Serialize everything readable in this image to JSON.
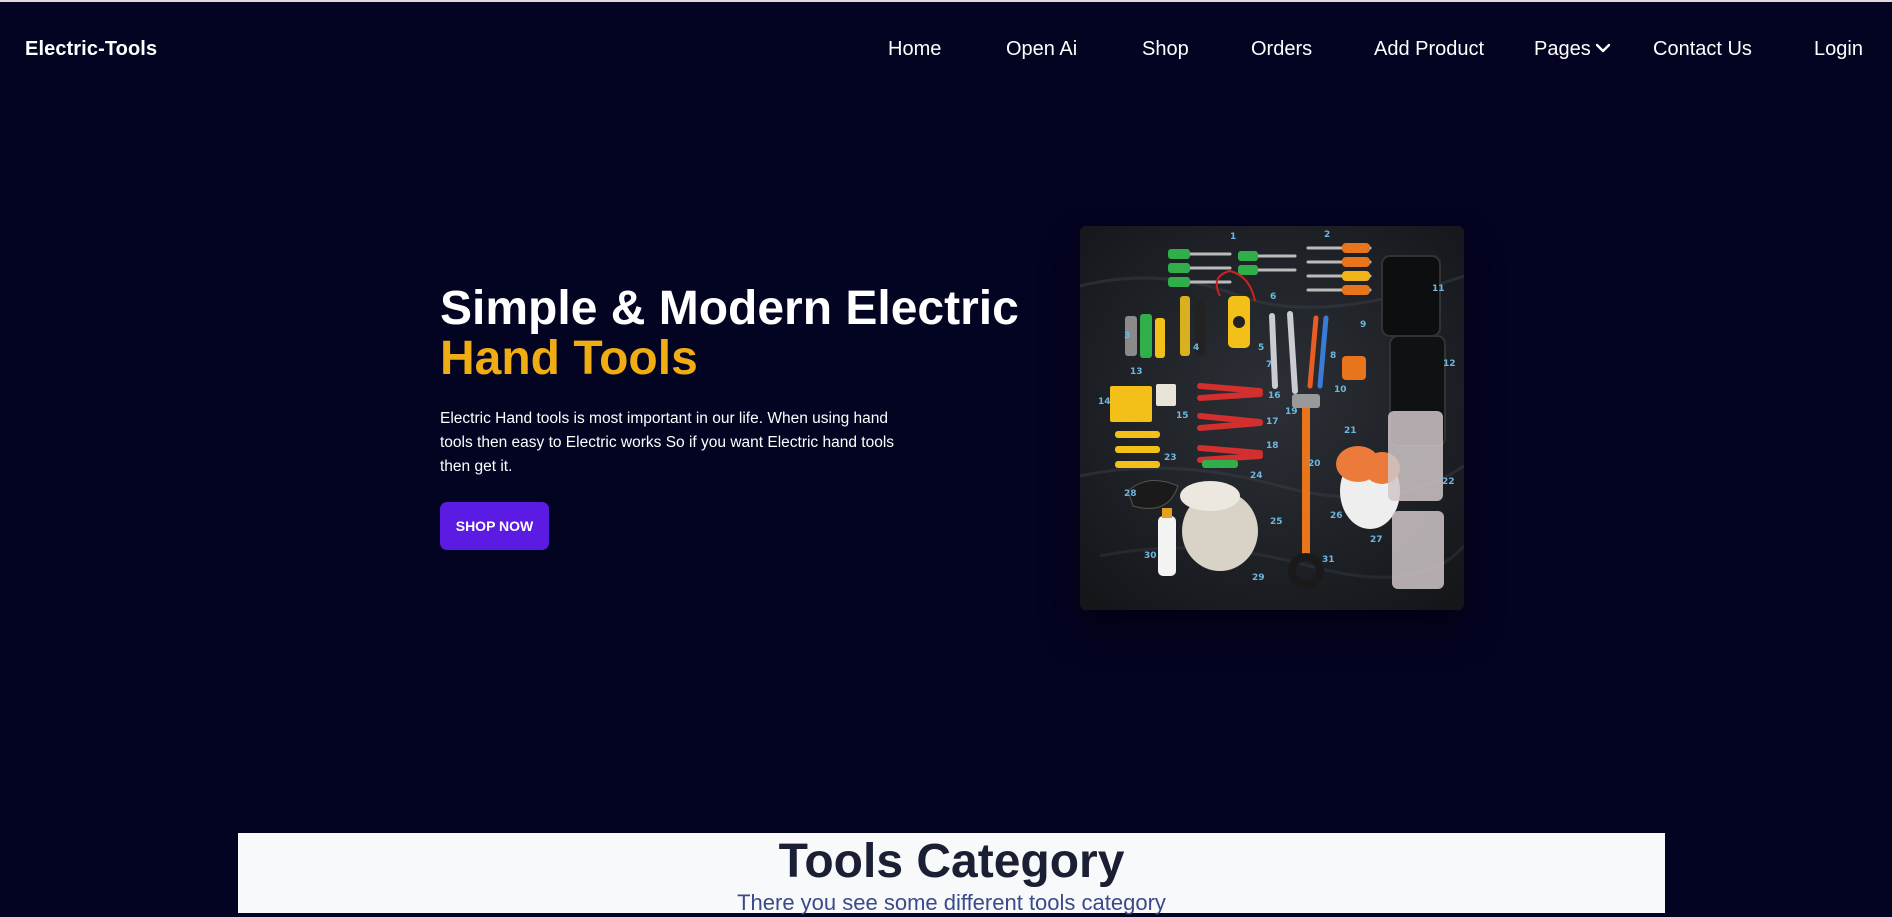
{
  "brand": "Electric-Tools",
  "nav": {
    "home": "Home",
    "openai": "Open Ai",
    "shop": "Shop",
    "orders": "Orders",
    "add_product": "Add Product",
    "pages": "Pages",
    "contact": "Contact Us",
    "login": "Login"
  },
  "hero": {
    "title_line1": "Simple & Modern Electric",
    "title_line2": "Hand Tools",
    "description": "Electric Hand tools is most important in our life. When using hand tools then easy to Electric works So if you want Electric hand tools then get it.",
    "button": "SHOP NOW",
    "accent_color": "#f0ac13",
    "button_color": "#5b1be3"
  },
  "category": {
    "title": "Tools Category",
    "subtitle": "There you see some different tools category"
  },
  "icons": [
    "chevron-down-icon"
  ]
}
